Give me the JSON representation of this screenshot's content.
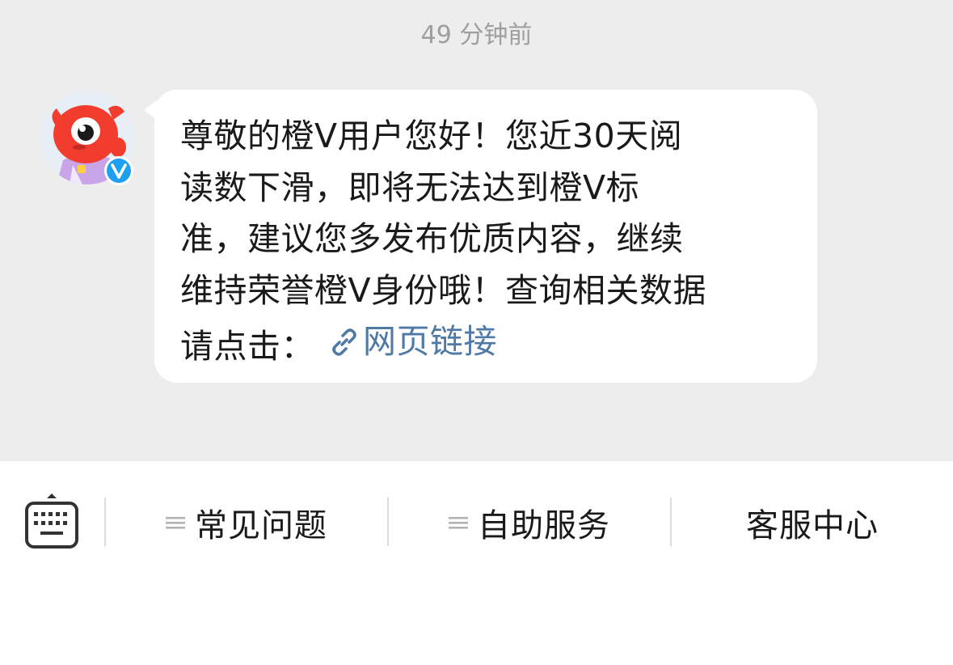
{
  "chat": {
    "timestamp": "49 分钟前",
    "message": {
      "lines": [
        "尊敬的橙Ⅴ用户您好！您近30天阅",
        "读数下滑，即将无法达到橙Ⅴ标",
        "准，建议您多发布优质内容，继续",
        "维持荣誉橙Ⅴ身份哦！查询相关数据"
      ],
      "last_line_prefix": "请点击：",
      "link_label": "网页链接"
    },
    "avatar": {
      "icon": "weibo-mascot-icon",
      "badge": "V",
      "badge_color": "#1e9ff2"
    }
  },
  "toolbar": {
    "keyboard_icon": "keyboard-icon",
    "buttons": [
      {
        "label": "常见问题",
        "icon": "menu-icon"
      },
      {
        "label": "自助服务",
        "icon": "menu-icon"
      },
      {
        "label": "客服中心"
      }
    ]
  },
  "colors": {
    "chat_background": "#ededed",
    "bubble": "#ffffff",
    "link": "#4f7aa6",
    "timestamp": "#9e9e9e"
  }
}
